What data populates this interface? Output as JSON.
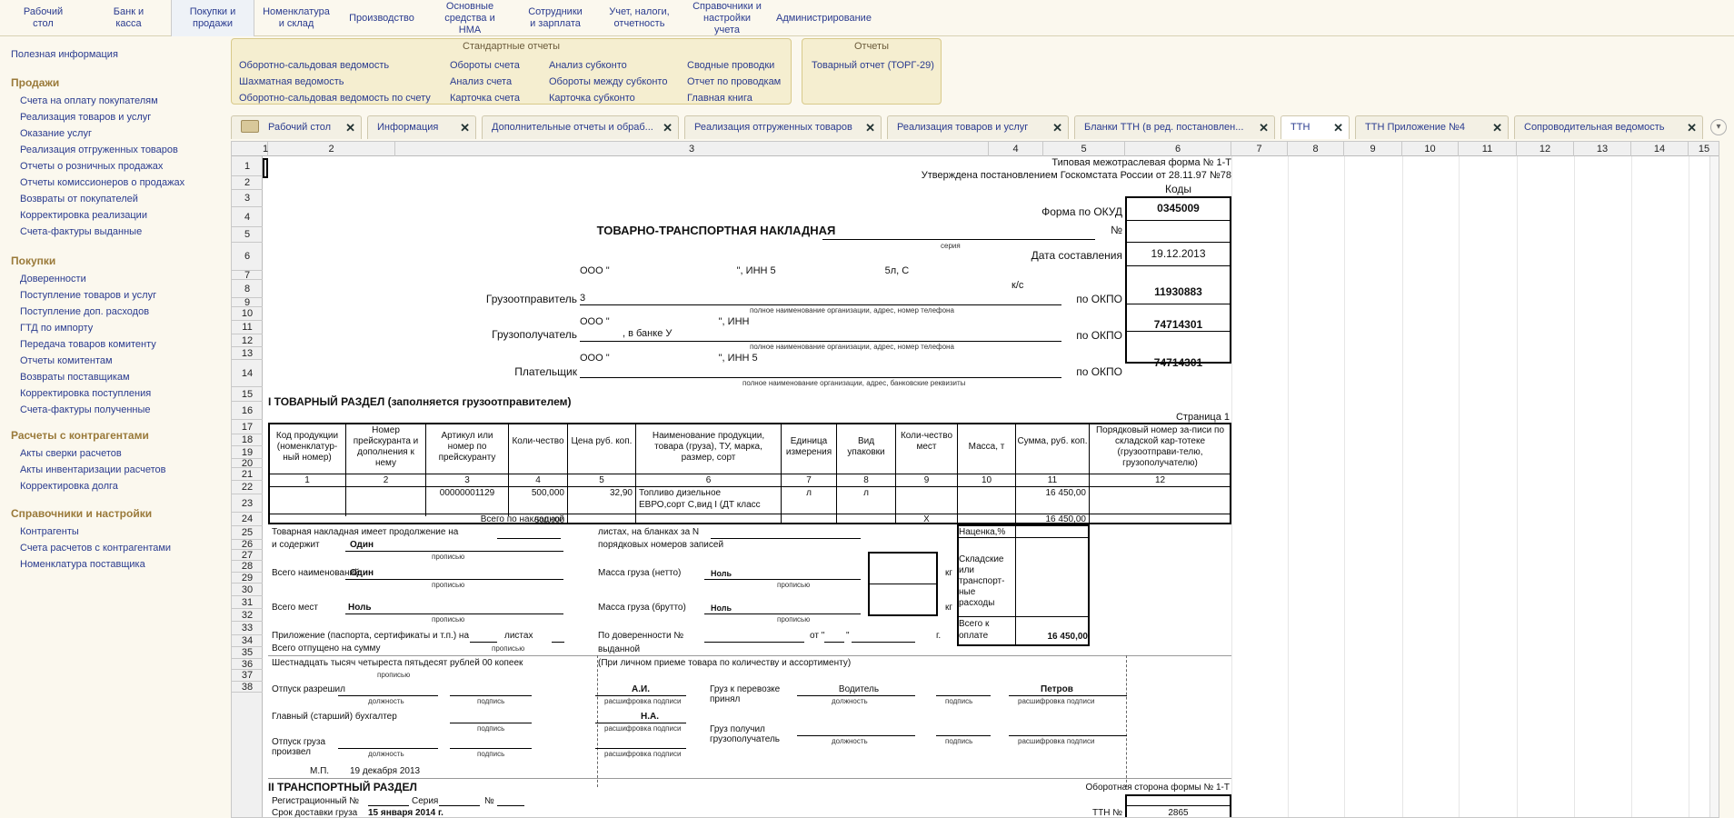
{
  "topmenu": [
    "Рабочий\nстол",
    "Банк и\nкасса",
    "Покупки и\nпродажи",
    "Номенклатура\nи склад",
    "Производство",
    "Основные\nсредства и НМА",
    "Сотрудники\nи зарплата",
    "Учет, налоги,\nотчетность",
    "Справочники и\nнастройки учета",
    "Администрирование"
  ],
  "leftnav": {
    "useful": "Полезная информация",
    "groups": [
      {
        "title": "Продажи",
        "items": [
          "Счета на оплату покупателям",
          "Реализация товаров и услуг",
          "Оказание услуг",
          "Реализация отгруженных товаров",
          "Отчеты о розничных продажах",
          "Отчеты комиссионеров о продажах",
          "Возвраты от покупателей",
          "Корректировка реализации",
          "Счета-фактуры выданные"
        ]
      },
      {
        "title": "Покупки",
        "items": [
          "Доверенности",
          "Поступление товаров и услуг",
          "Поступление доп. расходов",
          "ГТД по импорту",
          "Передача товаров комитенту",
          "Отчеты комитентам",
          "Возвраты поставщикам",
          "Корректировка поступления",
          "Счета-фактуры полученные"
        ]
      },
      {
        "title": "Расчеты с контрагентами",
        "items": [
          "Акты сверки расчетов",
          "Акты инвентаризации расчетов",
          "Корректировка долга"
        ]
      },
      {
        "title": "Справочники и настройки",
        "items": [
          "Контрагенты",
          "Счета расчетов с контрагентами",
          "Номенклатура поставщика"
        ]
      }
    ]
  },
  "std_reports": {
    "title": "Стандартные отчеты",
    "col1": [
      "Оборотно-сальдовая ведомость",
      "Шахматная ведомость",
      "Оборотно-сальдовая ведомость по счету"
    ],
    "col2": [
      "Обороты счета",
      "Анализ счета",
      "Карточка счета"
    ],
    "col3": [
      "Анализ субконто",
      "Обороты между субконто",
      "Карточка субконто"
    ],
    "col4": [
      "Сводные проводки",
      "Отчет по проводкам",
      "Главная книга"
    ]
  },
  "reports": {
    "title": "Отчеты",
    "items": [
      "Товарный отчет (ТОРГ-29)"
    ]
  },
  "tabs": [
    "Рабочий стол",
    "Информация",
    "Дополнительные отчеты и обраб...",
    "Реализация отгруженных товаров",
    "Реализация товаров и услуг",
    "Бланки ТТН (в ред. постановлен...",
    "ТТН",
    "ТТН Приложение №4",
    "Сопроводительная ведомость"
  ],
  "sheet": {
    "colnums": [
      "1",
      "2",
      "3",
      "4",
      "5",
      "6",
      "7",
      "8",
      "9",
      "10",
      "11",
      "12",
      "13",
      "14",
      "15"
    ],
    "rownums": [
      "1",
      "2",
      "3",
      "4",
      "5",
      "6",
      "7",
      "8",
      "9",
      "10",
      "11",
      "12",
      "13",
      "14",
      "15",
      "16",
      "17",
      "18",
      "19",
      "20",
      "21",
      "22",
      "23",
      "24",
      "25",
      "26",
      "27",
      "28",
      "29",
      "30",
      "31",
      "32",
      "33",
      "34",
      "35",
      "36",
      "37",
      "38"
    ],
    "form_type": "Типовая межотраслевая форма № 1-Т",
    "approved": "Утверждена постановлением Госкомстата России от 28.11.97 №78",
    "codes": "Коды",
    "okud_label": "Форма по ОКУД",
    "okud": "0345009",
    "title": "ТОВАРНО-ТРАНСПОРТНАЯ НАКЛАДНАЯ",
    "num_label": "№",
    "series": "серия",
    "date_label": "Дата составления",
    "date": "19.12.2013",
    "shipper_label": "Грузоотправитель",
    "shipper_text1": "ООО \"",
    "shipper_text2": "\", ИНН 5",
    "shipper_text3": "5л, С",
    "shipper_text4": "к/с",
    "shipper_text5": "3",
    "org_hint": "полное наименование организации, адрес, номер телефона",
    "okpo_label": "по ОКПО",
    "okpo1": "11930883",
    "consignee_label": "Грузополучатель",
    "consignee_text1": "ООО \"",
    "consignee_text2": "\", ИНН",
    "consignee_text3": ", в банке У",
    "okpo2": "74714301",
    "payer_label": "Плательщик",
    "payer_text1": "ООО \"",
    "payer_text2": "\", ИНН 5",
    "payer_hint": "полное наименование организации, адрес, банковские реквизиты",
    "okpo3": "74714301",
    "section1": "I ТОВАРНЫЙ РАЗДЕЛ (заполняется грузоотправителем)",
    "page": "Страница 1",
    "headers": [
      "Код продукции (номенклатур-ный номер)",
      "Номер прейскуранта и дополнения к нему",
      "Артикул или номер по прейскуранту",
      "Коли-чество",
      "Цена руб. коп.",
      "Наименование продукции, товара (груза), ТУ, марка, размер, сорт",
      "Единица измерения",
      "Вид упаковки",
      "Коли-чество мест",
      "Масса, т",
      "Сумма, руб. коп.",
      "Порядковый номер за-писи по складской кар-тотеке (грузоотправи-телю, грузополучателю)"
    ],
    "header_nums": [
      "1",
      "2",
      "3",
      "4",
      "5",
      "6",
      "7",
      "8",
      "9",
      "10",
      "11",
      "12"
    ],
    "row": {
      "article": "00000001129",
      "qty": "500,000",
      "price": "32,90",
      "name1": "Топливо дизельное",
      "name2": "ЕВРО,сорт С,вид I (ДТ класс",
      "unit": "л",
      "pack": "л",
      "sum": "16 450,00"
    },
    "total_label": "Всего по накладной",
    "total_qty": "500,000",
    "total_x": "X",
    "total_sum": "16 450,00",
    "r18a": "Товарная накладная имеет продолжение на",
    "r18b": "листах, на бланках за N",
    "markup": "Наценка,%",
    "r19a": "и содержит",
    "r19b": "Один",
    "r19c": "порядковых номеров записей",
    "propis": "прописью",
    "r21a": "Всего наименований",
    "r21b": "Один",
    "net_label": "Масса груза (нетто)",
    "net_val": "Ноль",
    "kg": "кг",
    "warehouse": "Складские или транспорт-ные расходы",
    "places_label": "Всего мест",
    "places_val": "Ноль",
    "gross_label": "Масса груза (брутто)",
    "gross_val": "Ноль",
    "total_pay_label": "Всего к оплате",
    "total_pay": "16 450,00",
    "r25a": "Приложение (паспорта, сертификаты и т.п.) на",
    "r25b": "листах",
    "poa": "По доверенности №",
    "ot": "от \"",
    "quote2": "\"",
    "g": "г.",
    "r26a": "Всего отпущено на сумму",
    "vydannoi": "выданной",
    "amount_words": "Шестнадцать тысяч четыреста пятьдесят рублей 00 копеек",
    "personal": "(При личном приеме товара по количеству и ассортименту)",
    "release_allowed": "Отпуск разрешил",
    "position": "должность",
    "signature": "подпись",
    "decode": "расшифровка подписи",
    "sig1": "А.И.",
    "cargo_accepted": "Груз к перевозке принял",
    "driver": "Водитель",
    "petrov": "Петров",
    "chief_acc": "Главный (старший) бухгалтер",
    "sig2": "Н.А.",
    "cargo_received": "Груз получил грузополучатель",
    "release_made": "Отпуск груза произвел",
    "mp": "М.П.",
    "date_sig": "19 декабря 2013",
    "section2": "II ТРАНСПОРТНЫЙ РАЗДЕЛ",
    "back_side": "Оборотная сторона формы № 1-Т",
    "reg_label": "Регистрационный №",
    "series_label": "Серия",
    "no_label": "№",
    "delivery_label": "Срок доставки груза",
    "delivery_date": "15 января 2014 г.",
    "ttn_label": "ТТН №",
    "ttn_no": "2865"
  }
}
